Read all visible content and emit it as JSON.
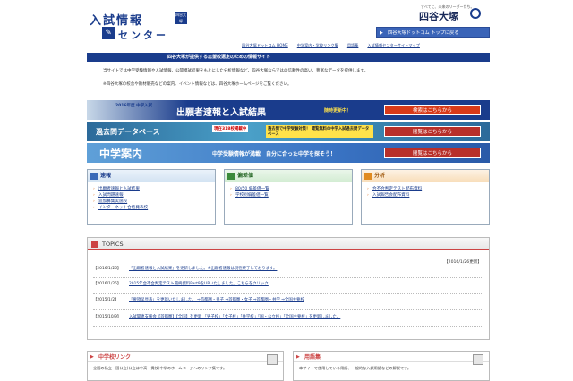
{
  "header": {
    "logo_line1": "入試情報",
    "logo_badge": "四谷大塚",
    "logo_line2": "センター",
    "brand_tagline": "すべてに、未来のリーダーたち。",
    "brand_name": "四谷大塚",
    "home_button": "四谷大塚ドットコム トップに戻る"
  },
  "breadcrumb": [
    "四谷大塚ドットコム HOME",
    "中学案内・学校リンク集",
    "用語集",
    "入試情報センターサイトマップ"
  ],
  "navbar_text": "四谷大塚が提供する志望校選定のための情報サイト",
  "intro": {
    "line1": "当サイトでは中学受験情報や入試情報、公開模試結果をもとにした分析情報など、四谷大塚ならではの信頼性の高い、豊富なデータを提供します。",
    "line2": "※四谷大塚の校舎や教材販売などの案内、イベント情報などは、四谷大塚ホームページをご覧ください。"
  },
  "banners": [
    {
      "year": "2016年度 中学入試",
      "title": "出願者速報と入試結果",
      "note": "随時更新中！",
      "button": "検索はこちらから"
    },
    {
      "title": "過去問データベース",
      "note": "現在318校掲載中",
      "sub": "過去問で中学受験対策！ 閲覧無料の中学入試過去問データベース",
      "button": "閲覧はこちらから"
    },
    {
      "title": "中学案内",
      "sub": "中学受験情報が満載　自分に合った中学を探そう！",
      "button": "閲覧はこちらから"
    }
  ],
  "panels": {
    "sokuho": {
      "title": "速報",
      "items": [
        "出願者速報と入試結果",
        "入試問題速報",
        "追加募集実施校",
        "インターネット合格発表校"
      ]
    },
    "hensachi": {
      "title": "偏差値",
      "items": [
        "80/50 偏差値一覧",
        "学校別偏差値一覧"
      ]
    },
    "bunseki": {
      "title": "分析",
      "items": [
        "合不合判定テスト配布資料",
        "入試報告会配布資料"
      ]
    }
  },
  "topics": {
    "title": "TOPICS",
    "updated": "【2016/1/26更新】",
    "rows": [
      {
        "date": "【2016/1/26】",
        "text": "「出願者速報と入試結果」を更新しました。※出願者速報は現在終了しております。"
      },
      {
        "date": "【2016/1/25】",
        "text": "2015年合不合判定テスト最終資料Part9をUPいたしました。こちらをクリック"
      },
      {
        "date": "【2015/1/2】",
        "text": "「要項早見表」を更新いたしました。 ⇒首都圏・男子 ⇒首都圏・女子 ⇒首都圏・共学 ⇒全国主要校"
      },
      {
        "date": "【2015/10/9】",
        "text": "入試関連支援会【首都圏】【全国】を更新 「男子校」「女子校」「共学校」「国・公立校」「全国主要校」を更新しました。"
      }
    ]
  },
  "bottom": {
    "left": {
      "title": "中学校リンク",
      "desc": "全国の私立・国公立(公立は中高一貫校)中学のホームページへのリンク集です。"
    },
    "right": {
      "title": "用語集",
      "desc": "本サイトで使用している用語、一般的な入試用語などの解説です。"
    }
  }
}
